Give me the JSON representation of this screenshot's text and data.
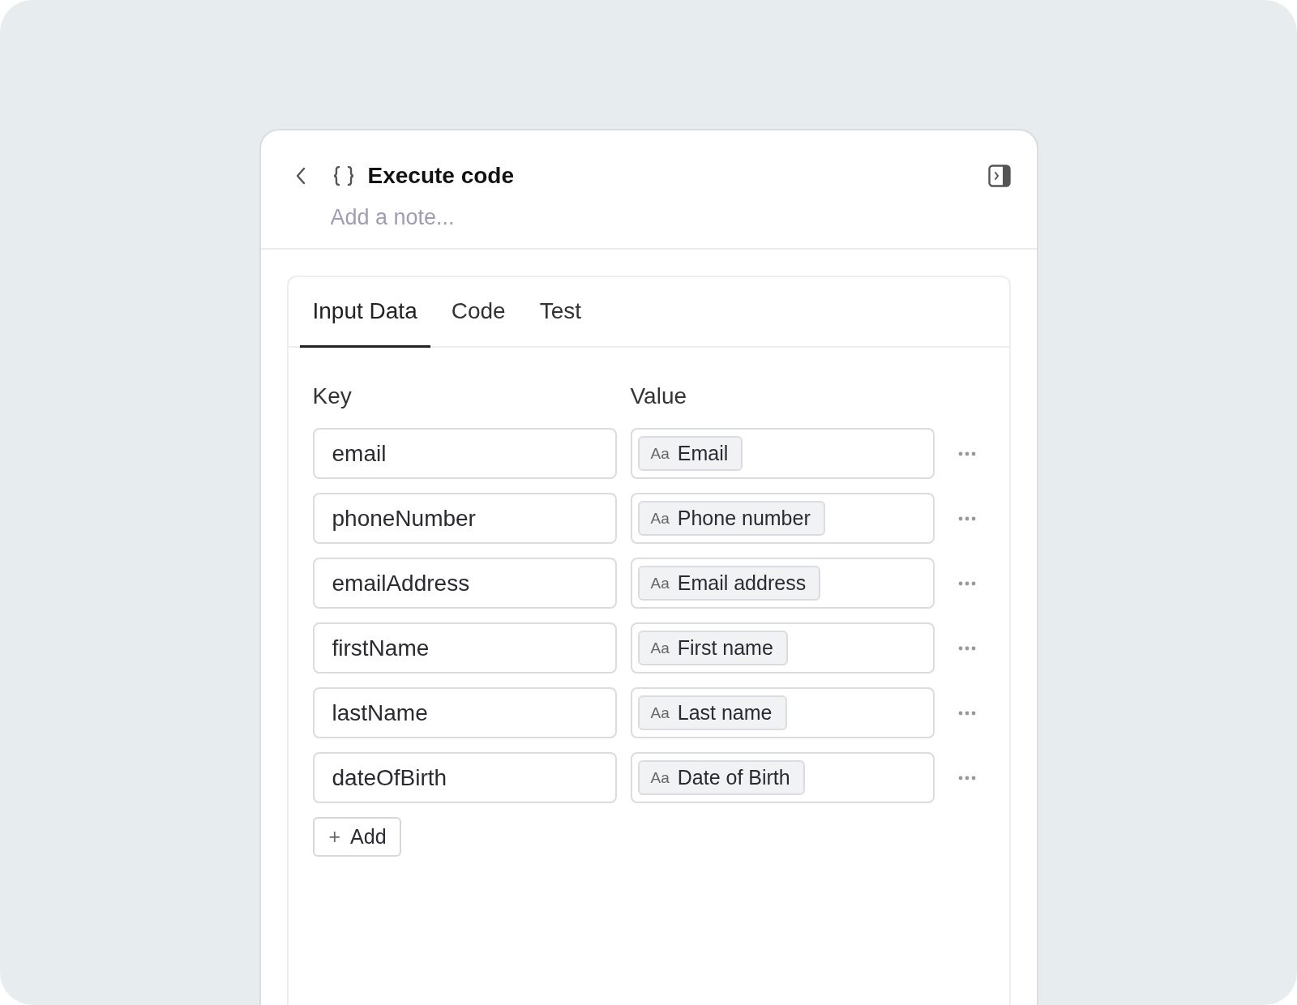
{
  "header": {
    "title": "Execute code",
    "note_placeholder": "Add a note..."
  },
  "tabs": [
    {
      "label": "Input Data",
      "selected": true
    },
    {
      "label": "Code",
      "selected": false
    },
    {
      "label": "Test",
      "selected": false
    }
  ],
  "columns": [
    "Key",
    "Value"
  ],
  "rows": [
    {
      "key": "email",
      "value_type": "Aa",
      "value": "Email"
    },
    {
      "key": "phoneNumber",
      "value_type": "Aa",
      "value": "Phone number"
    },
    {
      "key": "emailAddress",
      "value_type": "Aa",
      "value": "Email address"
    },
    {
      "key": "firstName",
      "value_type": "Aa",
      "value": "First name"
    },
    {
      "key": "lastName",
      "value_type": "Aa",
      "value": "Last name"
    },
    {
      "key": "dateOfBirth",
      "value_type": "Aa",
      "value": "Date of Birth"
    }
  ],
  "add_button": {
    "icon": "+",
    "label": "Add"
  }
}
